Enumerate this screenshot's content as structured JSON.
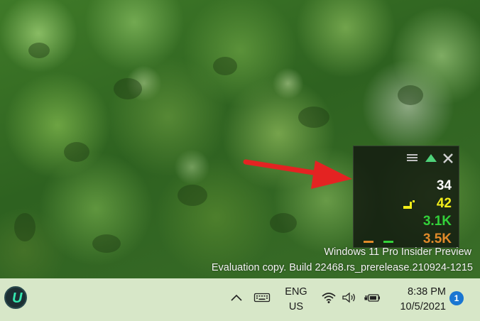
{
  "monitor_widget": {
    "metric_1": "34",
    "metric_2": "42",
    "metric_3": "3.1K",
    "metric_4": "3.5K",
    "colors": {
      "metric_1": "#ffffff",
      "metric_2": "#f2ee1a",
      "metric_3": "#33d13a",
      "metric_4": "#e08a2a"
    },
    "icons": {
      "menu": "hamburger-icon",
      "collapse": "triangle-up-icon",
      "close": "close-icon"
    }
  },
  "watermark": {
    "line1": "Windows 11 Pro Insider Preview",
    "line2": "Evaluation copy. Build 22468.rs_prerelease.210924-1215"
  },
  "taskbar": {
    "app_letter": "U",
    "language": "ENG",
    "region": "US",
    "time": "8:38 PM",
    "date": "10/5/2021",
    "notification_count": "1",
    "icons": [
      "chevron-up-icon",
      "keyboard-icon",
      "wifi-icon",
      "speaker-icon",
      "battery-icon"
    ]
  },
  "annotation": {
    "arrow_color": "#e42322"
  }
}
